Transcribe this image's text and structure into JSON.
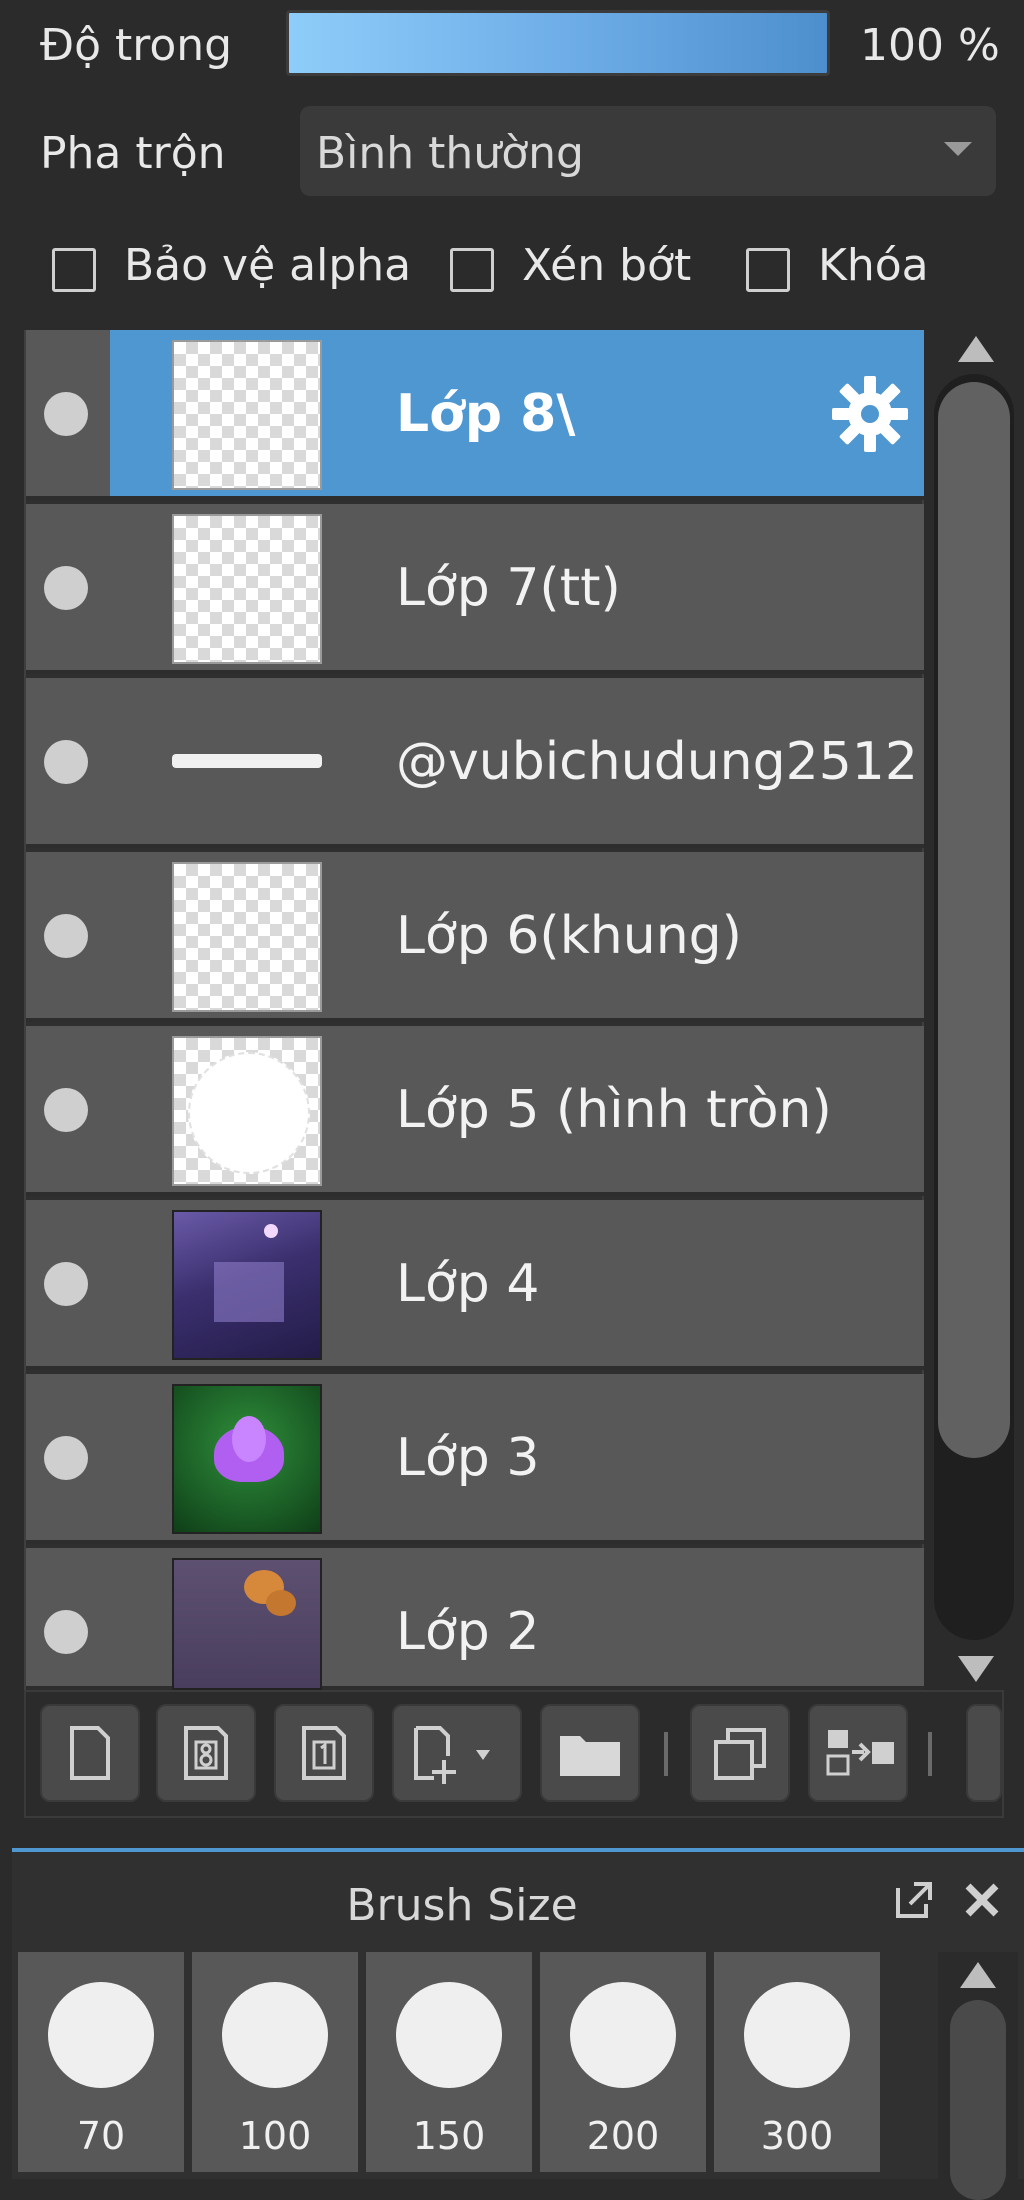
{
  "opacity": {
    "label": "Độ trong",
    "value_text": "100 %",
    "value": 100
  },
  "blend": {
    "label": "Pha trộn",
    "value": "Bình thường"
  },
  "checkboxes": [
    {
      "label": "Bảo vệ alpha",
      "checked": false
    },
    {
      "label": "Xén bớt",
      "checked": false
    },
    {
      "label": "Khóa",
      "checked": false
    }
  ],
  "layers": [
    {
      "name": "Lớp 8\\",
      "active": true,
      "thumb": "transparent"
    },
    {
      "name": "Lớp 7(tt)",
      "active": false,
      "thumb": "transparent"
    },
    {
      "name": "@vubichudung2512",
      "active": false,
      "thumb": "text-stroke"
    },
    {
      "name": "Lớp 6(khung)",
      "active": false,
      "thumb": "transparent"
    },
    {
      "name": "Lớp 5 (hình tròn)",
      "active": false,
      "thumb": "circle"
    },
    {
      "name": "Lớp 4",
      "active": false,
      "thumb": "purple-scene"
    },
    {
      "name": "Lớp 3",
      "active": false,
      "thumb": "lotus"
    },
    {
      "name": "Lớp 2",
      "active": false,
      "thumb": "orange-flowers"
    }
  ],
  "toolbar_icons": [
    "new-layer-icon",
    "new-8bit-layer-icon",
    "new-1bit-layer-icon",
    "add-layer-dropdown-icon",
    "folder-icon",
    "duplicate-layer-icon",
    "merge-down-icon"
  ],
  "brush_panel": {
    "title": "Brush Size",
    "sizes": [
      "70",
      "100",
      "150",
      "200",
      "300"
    ]
  },
  "colors": {
    "accent": "#4f97d1",
    "panel": "#585858",
    "background": "#2b2b2b"
  }
}
